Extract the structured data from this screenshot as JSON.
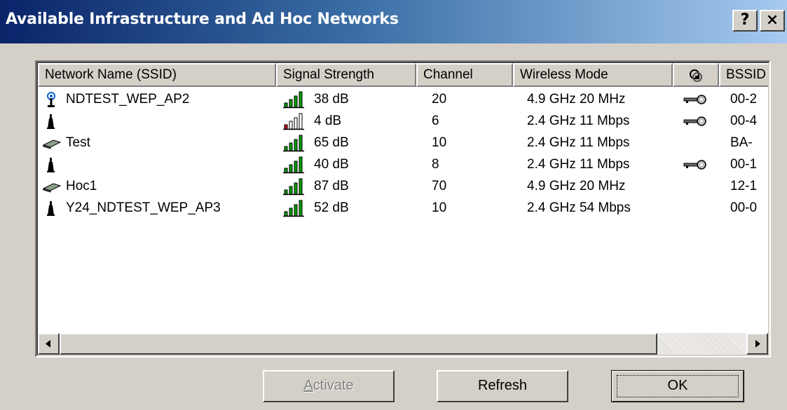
{
  "window": {
    "title": "Available Infrastructure and Ad Hoc Networks",
    "help_label": "?",
    "close_label": "×"
  },
  "columns": {
    "ssid": "Network Name (SSID)",
    "signal": "Signal Strength",
    "channel": "Channel",
    "mode": "Wireless Mode",
    "security_icon": "lock-icon",
    "bssid": "BSSID"
  },
  "networks": [
    {
      "ssid": "NDTEST_WEP_AP2",
      "icon": "access-point-icon",
      "signal_level": 4,
      "signal": "38 dB",
      "channel": "20",
      "mode": "4.9 GHz 20 MHz",
      "encrypted": true,
      "bssid": "00-2"
    },
    {
      "ssid": "",
      "icon": "antenna-icon",
      "signal_level": 1,
      "signal": "4 dB",
      "channel": "6",
      "mode": "2.4 GHz 11 Mbps",
      "encrypted": true,
      "bssid": "00-4"
    },
    {
      "ssid": "Test",
      "icon": "adhoc-card-icon",
      "signal_level": 4,
      "signal": "65 dB",
      "channel": "10",
      "mode": "2.4 GHz 11 Mbps",
      "encrypted": false,
      "bssid": "BA-"
    },
    {
      "ssid": "",
      "icon": "antenna-icon",
      "signal_level": 4,
      "signal": "40 dB",
      "channel": "8",
      "mode": "2.4 GHz 11 Mbps",
      "encrypted": true,
      "bssid": "00-1"
    },
    {
      "ssid": "Hoc1",
      "icon": "adhoc-card-icon",
      "signal_level": 4,
      "signal": "87 dB",
      "channel": "70",
      "mode": "4.9 GHz 20 MHz",
      "encrypted": false,
      "bssid": "12-1"
    },
    {
      "ssid": "Y24_NDTEST_WEP_AP3",
      "icon": "antenna-icon",
      "signal_level": 4,
      "signal": "52 dB",
      "channel": "10",
      "mode": "2.4 GHz 54 Mbps",
      "encrypted": false,
      "bssid": "00-0"
    }
  ],
  "buttons": {
    "activate": "Activate",
    "refresh": "Refresh",
    "ok": "OK"
  },
  "colors": {
    "signal_good": "#00a000",
    "signal_weak": "#c00000"
  }
}
